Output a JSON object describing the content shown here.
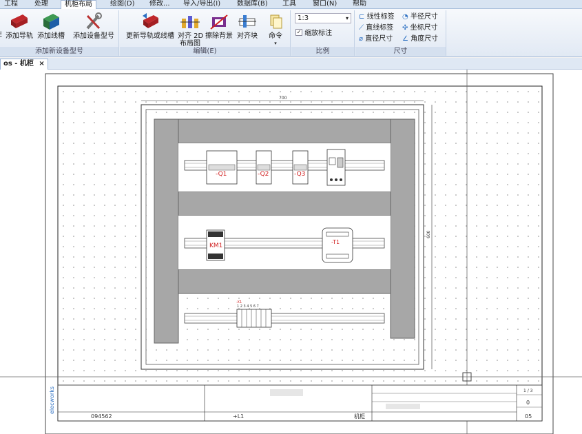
{
  "menu": {
    "items": [
      {
        "label": "工程",
        "active": false
      },
      {
        "label": "处理",
        "active": false
      },
      {
        "label": "机柜布局",
        "active": true
      },
      {
        "label": "绘图(D)",
        "active": false
      },
      {
        "label": "修改...",
        "active": false
      },
      {
        "label": "导入/导出(I)",
        "active": false
      },
      {
        "label": "数据库(B)",
        "active": false
      },
      {
        "label": "工具",
        "active": false
      },
      {
        "label": "窗口(N)",
        "active": false
      },
      {
        "label": "帮助",
        "active": false
      }
    ]
  },
  "ribbon": {
    "group1": {
      "caption": "添加新设备型号",
      "buttons": {
        "add_rail": "添加导轨",
        "add_duct": "添加线槽",
        "add_device_model": "添加设备型号"
      },
      "cut_left": "E"
    },
    "group2": {
      "caption": "编辑(E)",
      "buttons": {
        "update_rail": "更新导轨或线槽",
        "align2d_line1": "对齐 2D",
        "align2d_line2": "布局图",
        "erase_bg": "擦除背景",
        "align_block": "对齐块",
        "command": "命令"
      }
    },
    "group3": {
      "caption": "比例",
      "scale_value": "1:3",
      "zoom_label": "缩放标注"
    },
    "group4": {
      "caption": "尺寸",
      "buttons": {
        "linear_label": "线性标签",
        "radius_dim": "半径尺寸",
        "line_label": "直线标签",
        "coord_dim": "坐标尺寸",
        "diameter_dim": "直径尺寸",
        "angle_dim": "角度尺寸"
      }
    }
  },
  "document_tab": {
    "label": "os - 机柜"
  },
  "drawing": {
    "dim_width": "700",
    "dim_height": "600",
    "labels": {
      "q1": "-Q1",
      "q2": "-Q2",
      "q3": "-Q3",
      "km1": "KM1",
      "t1": "-T1",
      "x1": "-X1",
      "terminals": "1 2 3 4 5 6 7"
    },
    "title_block": {
      "code": "094562",
      "location": "+L1",
      "type": "机柜",
      "sheet": "1 / 3",
      "revision": "0",
      "number": "05",
      "logo": "elecworks"
    }
  },
  "colors": {
    "ribbon_bg": "#e1e9f4",
    "duct_gray": "#a7a7a7",
    "mount_gray": "#d2d2d2",
    "label_red": "#d02020"
  }
}
